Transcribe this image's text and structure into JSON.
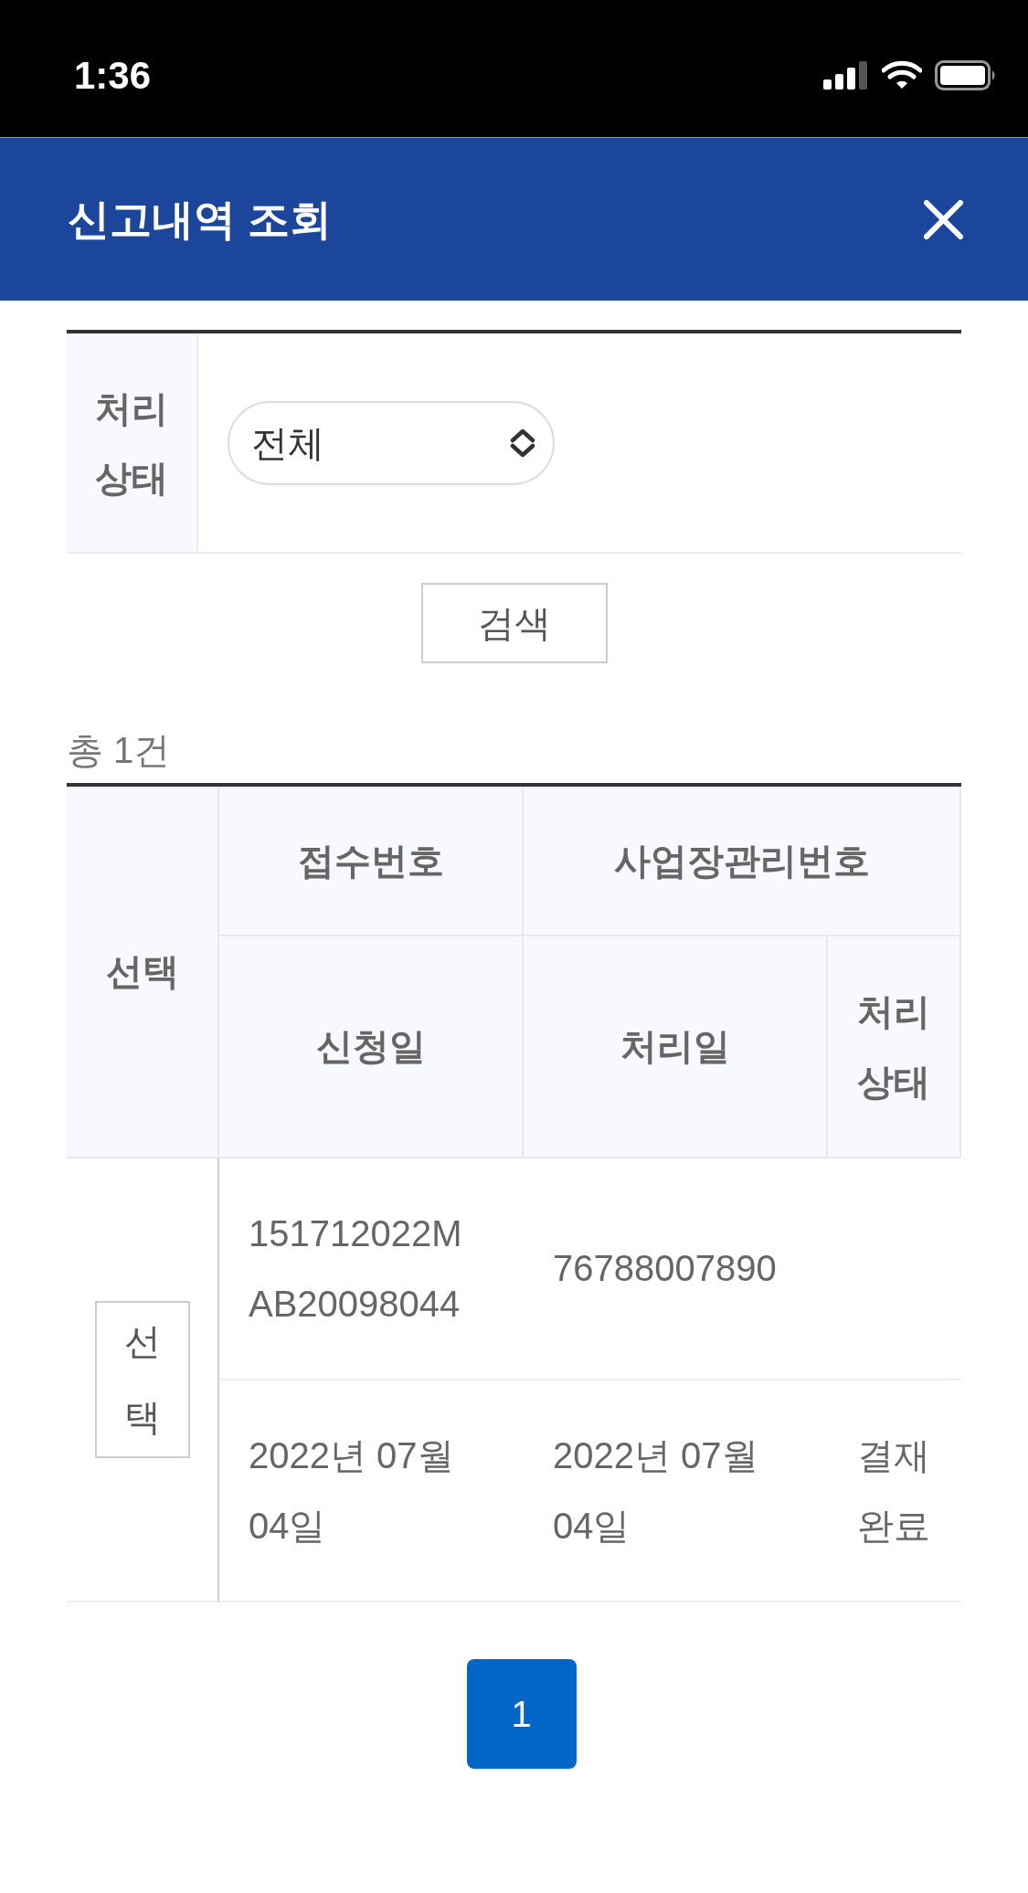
{
  "status_bar": {
    "time": "1:36"
  },
  "header": {
    "title": "신고내역 조회"
  },
  "filter": {
    "label": "처리 상태",
    "select": {
      "value": "전체"
    }
  },
  "search_button": "검색",
  "total": "총 1건",
  "table": {
    "headers": {
      "select": "선택",
      "receipt_no": "접수번호",
      "workplace_no": "사업장관리번호",
      "applied_date": "신청일",
      "processed_date": "처리일",
      "status": "처리 상태"
    },
    "rows": [
      {
        "select_button": "선택",
        "receipt_no": "151712022MAB20098044",
        "workplace_no": "76788007890",
        "applied_date": "2022년 07월 04일",
        "processed_date": "2022년 07월 04일",
        "status": "결재 완료"
      }
    ]
  },
  "pagination": {
    "pages": [
      {
        "label": "1",
        "selected": true
      }
    ]
  }
}
